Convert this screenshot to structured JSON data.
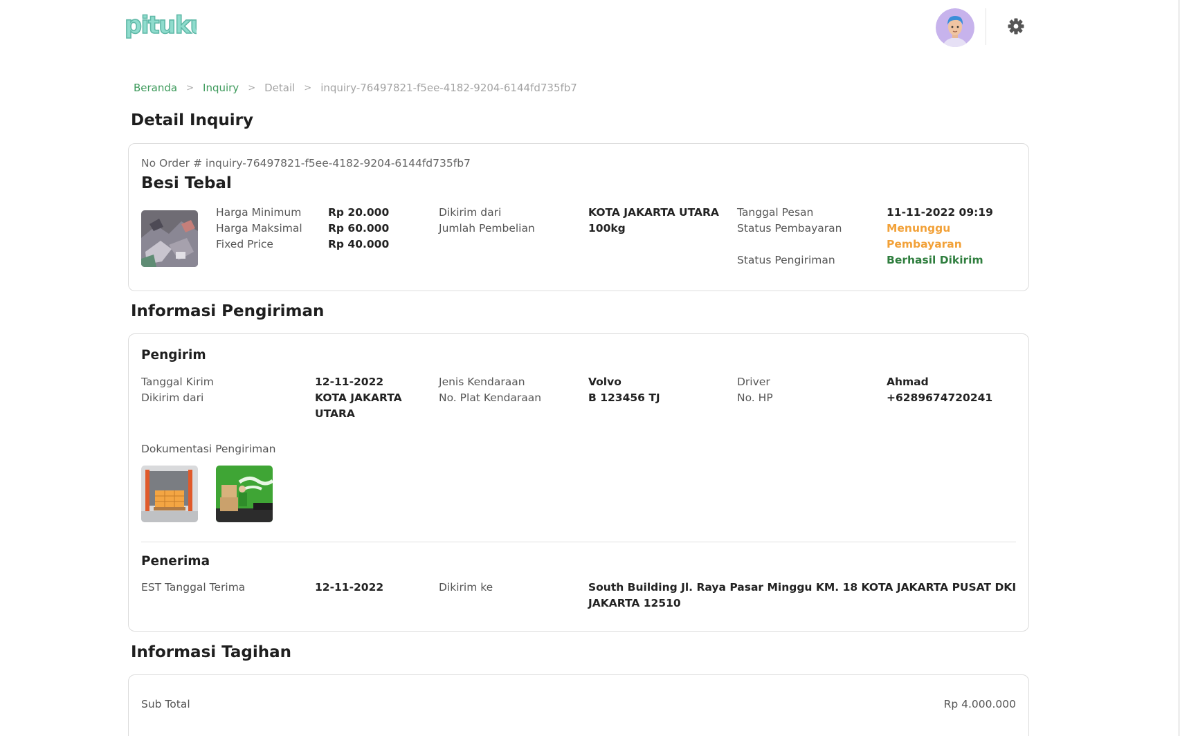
{
  "header": {
    "logo_text": "pituku",
    "avatar_alt": "User avatar",
    "settings_icon": "gear-icon"
  },
  "breadcrumb": [
    "Beranda",
    "Inquiry",
    "Detail",
    "inquiry-76497821-f5ee-4182-9204-6144fd735fb7"
  ],
  "breadcrumb_sep": ">",
  "detail": {
    "title": "Detail Inquiry",
    "order_no": "No Order # inquiry-76497821-f5ee-4182-9204-6144fd735fb7",
    "product_name": "Besi Tebal",
    "harga_min_label": "Harga Minimum",
    "harga_min": "Rp 20.000",
    "harga_max_label": "Harga Maksimal",
    "harga_max": "Rp 60.000",
    "fixed_price_label": "Fixed Price",
    "fixed_price": "Rp 40.000",
    "dikirim_dari_label": "Dikirim dari",
    "dikirim_dari": "KOTA JAKARTA UTARA",
    "jumlah_label": "Jumlah Pembelian",
    "jumlah": "100kg",
    "tanggal_pesan_label": "Tanggal Pesan",
    "tanggal_pesan": "11-11-2022 09:19",
    "status_bayar_label": "Status Pembayaran",
    "status_bayar_line1": "Menunggu",
    "status_bayar_line2": "Pembayaran",
    "status_kirim_label": "Status Pengiriman",
    "status_kirim": "Berhasil Dikirim",
    "status_colors": {
      "waiting": "#f2a138",
      "success": "#2f7e3e"
    }
  },
  "shipping": {
    "title": "Informasi Pengiriman",
    "pengirim_title": "Pengirim",
    "tanggal_kirim_label": "Tanggal Kirim",
    "tanggal_kirim": "12-11-2022",
    "dikirim_dari_label": "Dikirim dari",
    "dikirim_dari_line1": "KOTA JAKARTA",
    "dikirim_dari_line2": "UTARA",
    "jenis_kendaraan_label": "Jenis Kendaraan",
    "jenis_kendaraan": "Volvo",
    "plat_label": "No. Plat Kendaraan",
    "plat": "B 123456 TJ",
    "driver_label": "Driver",
    "driver": "Ahmad",
    "hp_label": "No. HP",
    "hp": "+6289674720241",
    "dokumentasi_label": "Dokumentasi Pengiriman",
    "penerima_title": "Penerima",
    "est_label": "EST Tanggal Terima",
    "est": "12-11-2022",
    "dikirim_ke_label": "Dikirim ke",
    "dikirim_ke_line1": "South Building Jl. Raya Pasar Minggu KM. 18 KOTA JAKARTA PUSAT DKI",
    "dikirim_ke_line2": "JAKARTA 12510"
  },
  "billing": {
    "title": "Informasi Tagihan",
    "subtotal_label": "Sub Total",
    "subtotal": "Rp 4.000.000"
  },
  "colors": {
    "brand": "#7fd3c4",
    "link": "#3d9a5b"
  }
}
